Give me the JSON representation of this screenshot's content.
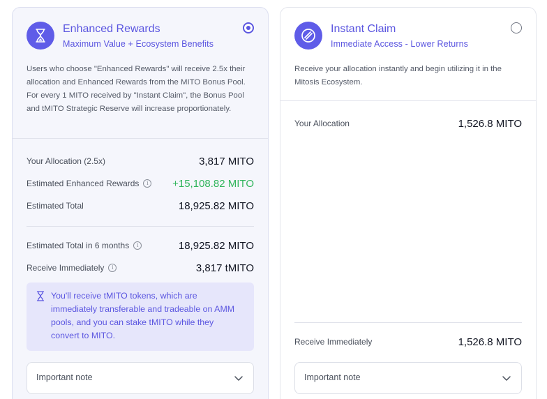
{
  "enhanced": {
    "title": "Enhanced Rewards",
    "subtitle": "Maximum Value + Ecosystem Benefits",
    "selected": true,
    "description": "Users who choose \"Enhanced Rewards\" will receive 2.5x their allocation and Enhanced Rewards from the MITO Bonus Pool. For every 1 MITO received by \"Instant Claim\", the Bonus Pool and tMITO Strategic Reserve will increase proportionately.",
    "rows": [
      {
        "label": "Your Allocation (2.5x)",
        "value": "3,817 MITO"
      },
      {
        "label": "Estimated Enhanced Rewards",
        "value": "+15,108.82 MITO"
      },
      {
        "label": "Estimated Total",
        "value": "18,925.82 MITO"
      },
      {
        "label": "Estimated Total in 6 months",
        "value": "18,925.82 MITO"
      },
      {
        "label": "Receive Immediately",
        "value": "3,817 tMITO"
      }
    ],
    "notice": "You'll receive tMITO tokens, which are immediately transferable and tradeable on AMM pools, and you can stake tMITO while they convert to MITO.",
    "note_label": "Important note"
  },
  "instant": {
    "title": "Instant Claim",
    "subtitle": "Immediate Access - Lower Returns",
    "selected": false,
    "description": "Receive your allocation instantly and begin utilizing it in the Mitosis Ecosystem.",
    "rows": [
      {
        "label": "Your Allocation",
        "value": "1,526.8 MITO"
      },
      {
        "label": "Receive Immediately",
        "value": "1,526.8 MITO"
      }
    ],
    "note_label": "Important note"
  },
  "colors": {
    "accent": "#5b56e0",
    "positive": "#31b55c"
  },
  "icons": [
    "hourglass-icon",
    "instant-claim-icon",
    "info-icon",
    "chevron-down-icon"
  ]
}
